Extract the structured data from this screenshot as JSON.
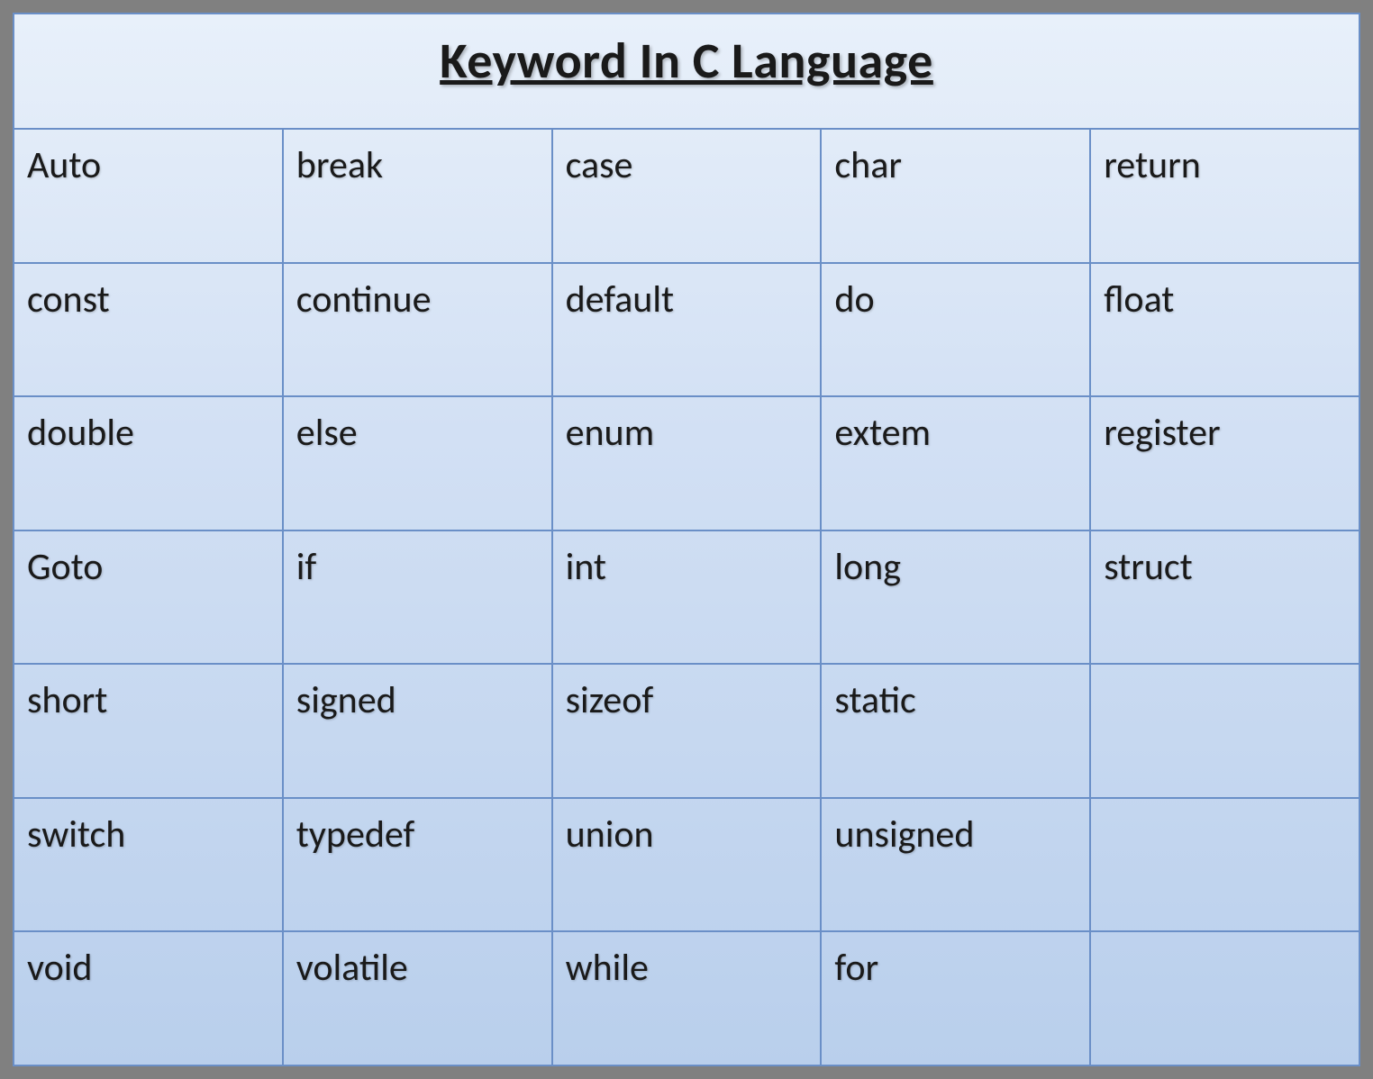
{
  "title": "Keyword In C Language",
  "rows": [
    [
      "Auto",
      "break",
      "case",
      "char",
      "return"
    ],
    [
      "const",
      "continue",
      "default",
      "do",
      "float"
    ],
    [
      "double",
      "else",
      "enum",
      "extem",
      "register"
    ],
    [
      "Goto",
      "if",
      "int",
      "long",
      "struct"
    ],
    [
      "short",
      "signed",
      "sizeof",
      "static",
      ""
    ],
    [
      "switch",
      "typedef",
      "union",
      "unsigned",
      ""
    ],
    [
      "void",
      "volatile",
      "while",
      "for",
      ""
    ]
  ]
}
